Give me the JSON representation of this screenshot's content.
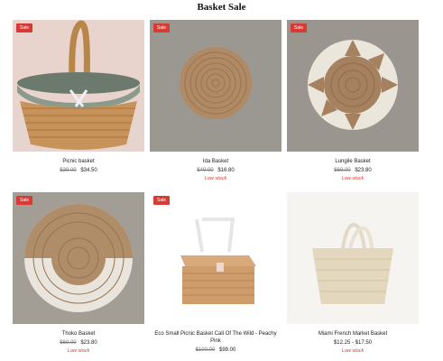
{
  "page": {
    "title": "Basket Sale"
  },
  "badge_label": "Sale",
  "products": [
    {
      "name": "Picnic basket",
      "old_price": "$39.00",
      "price": "$34.50",
      "stock": ""
    },
    {
      "name": "Ida Basket",
      "old_price": "$49.00",
      "price": "$16.80",
      "stock": "Low stock"
    },
    {
      "name": "Lungile Basket",
      "old_price": "$69.00",
      "price": "$23.80",
      "stock": "Low stock"
    },
    {
      "name": "Thoko Basket",
      "old_price": "$69.00",
      "price": "$23.80",
      "stock": "Low stock"
    },
    {
      "name": "Eco Small Picnic Basket Call Of The Wild - Peachy Pink",
      "old_price": "$100.00",
      "price": "$99.00",
      "stock": ""
    },
    {
      "name": "Miami French Market Basket",
      "old_price": "",
      "price": "$12.25 - $17.50",
      "stock": "Low stock"
    }
  ],
  "colors": {
    "badge": "#d83a34",
    "low_stock": "#d83a34"
  }
}
